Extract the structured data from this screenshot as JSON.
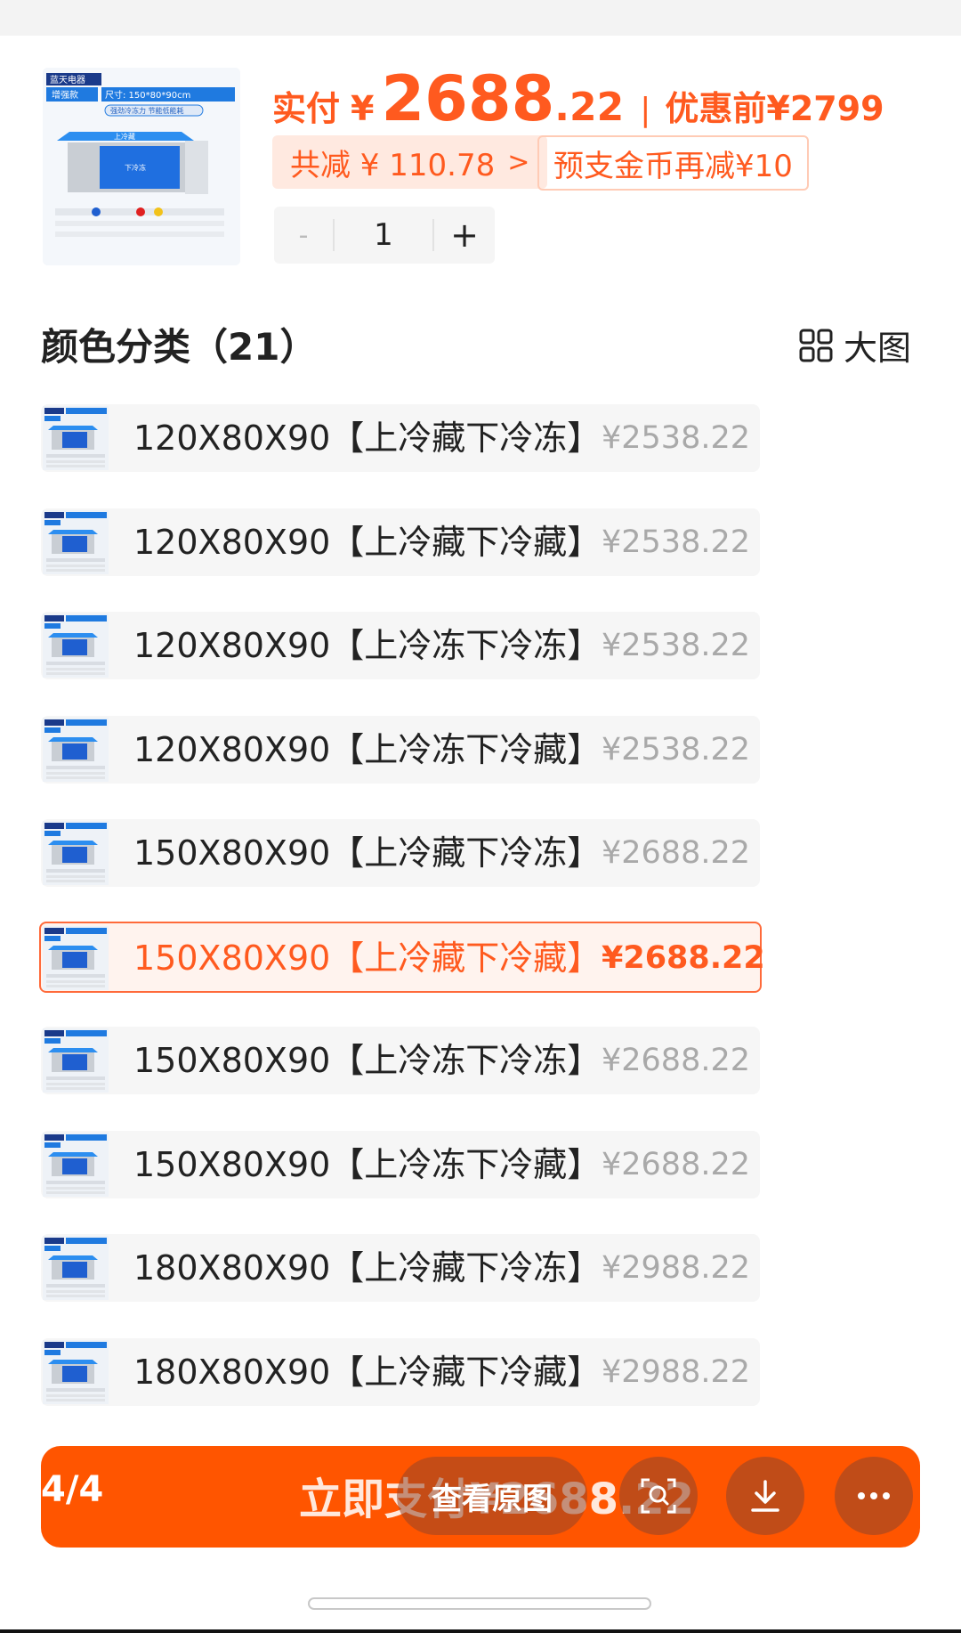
{
  "summary": {
    "pay_label": "实付",
    "yen": "¥",
    "price_int": "2688",
    "price_dec": ".22",
    "separator": "|",
    "before_label": "优惠前",
    "before_price": "¥2799",
    "discount_text": "共减 ¥ 110.78",
    "discount_chevron": ">",
    "coin_text": "预支金币再减¥10",
    "quantity": "1",
    "minus": "-",
    "plus": "+"
  },
  "thumb": {
    "brand": "蓝天电器",
    "tag": "增强款",
    "size": "尺寸: 150*80*90cm",
    "feature": "强劲冷冻力 节能低能耗",
    "top_label": "上冷藏",
    "bottom_label": "下冷冻"
  },
  "section": {
    "title": "颜色分类（21）",
    "bigview_label": "大图"
  },
  "options": [
    {
      "name": "120X80X90【上冷藏下冷冻】",
      "price": "¥2538.22",
      "selected": false
    },
    {
      "name": "120X80X90【上冷藏下冷藏】",
      "price": "¥2538.22",
      "selected": false
    },
    {
      "name": "120X80X90【上冷冻下冷冻】",
      "price": "¥2538.22",
      "selected": false
    },
    {
      "name": "120X80X90【上冷冻下冷藏】",
      "price": "¥2538.22",
      "selected": false
    },
    {
      "name": "150X80X90【上冷藏下冷冻】",
      "price": "¥2688.22",
      "selected": false
    },
    {
      "name": "150X80X90【上冷藏下冷藏】",
      "price": "¥2688.22",
      "selected": true
    },
    {
      "name": "150X80X90【上冷冻下冷冻】",
      "price": "¥2688.22",
      "selected": false
    },
    {
      "name": "150X80X90【上冷冻下冷藏】",
      "price": "¥2688.22",
      "selected": false
    },
    {
      "name": "180X80X90【上冷藏下冷冻】",
      "price": "¥2988.22",
      "selected": false
    },
    {
      "name": "180X80X90【上冷藏下冷藏】",
      "price": "¥2988.22",
      "selected": false
    }
  ],
  "paybar": {
    "label": "立即支付¥2688.22",
    "counter": "4/4",
    "view_original": "查看原图"
  },
  "colors": {
    "accent": "#ff5500",
    "price_orange": "#ff5a1f",
    "discount_bg": "#ffe9e0"
  },
  "icons": [
    "grid-icon",
    "image-search-icon",
    "download-icon",
    "more-icon"
  ]
}
